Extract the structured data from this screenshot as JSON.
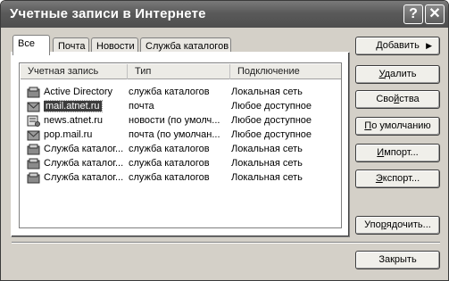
{
  "window": {
    "title": "Учетные записи в Интернете"
  },
  "titlebar_buttons": {
    "help": "?",
    "close": "✕"
  },
  "tabs": [
    {
      "label": "Все"
    },
    {
      "label": "Почта"
    },
    {
      "label": "Новости"
    },
    {
      "label": "Служба каталогов"
    }
  ],
  "list": {
    "columns": [
      "Учетная запись",
      "Тип",
      "Подключение"
    ],
    "rows": [
      {
        "account": "Active Directory",
        "type": "служба каталогов",
        "connection": "Локальная сеть",
        "icon": "directory-icon"
      },
      {
        "account": "mail.atnet.ru",
        "type": "почта",
        "connection": "Любое доступное",
        "icon": "mail-icon"
      },
      {
        "account": "news.atnet.ru",
        "type": "новости (по умолч...",
        "connection": "Любое доступное",
        "icon": "news-icon"
      },
      {
        "account": "pop.mail.ru",
        "type": "почта (по умолчан...",
        "connection": "Любое доступное",
        "icon": "mail-icon"
      },
      {
        "account": "Служба каталог...",
        "type": "служба каталогов",
        "connection": "Локальная сеть",
        "icon": "directory-icon"
      },
      {
        "account": "Служба каталог...",
        "type": "служба каталогов",
        "connection": "Локальная сеть",
        "icon": "directory-icon"
      },
      {
        "account": "Служба каталог...",
        "type": "служба каталогов",
        "connection": "Локальная сеть",
        "icon": "directory-icon"
      }
    ]
  },
  "buttons": {
    "add": {
      "pre": "",
      "mn": "Д",
      "post": "обавить"
    },
    "remove": {
      "pre": "",
      "mn": "У",
      "post": "далить"
    },
    "properties": {
      "pre": "Сво",
      "mn": "й",
      "post": "ства"
    },
    "default": {
      "pre": "",
      "mn": "П",
      "post": "о умолчанию"
    },
    "import": {
      "pre": "",
      "mn": "И",
      "post": "мпорт..."
    },
    "export": {
      "pre": "",
      "mn": "Э",
      "post": "кспорт..."
    },
    "order": {
      "pre": "Упо",
      "mn": "р",
      "post": "ядочить..."
    },
    "close": {
      "label": "Закрыть"
    }
  }
}
